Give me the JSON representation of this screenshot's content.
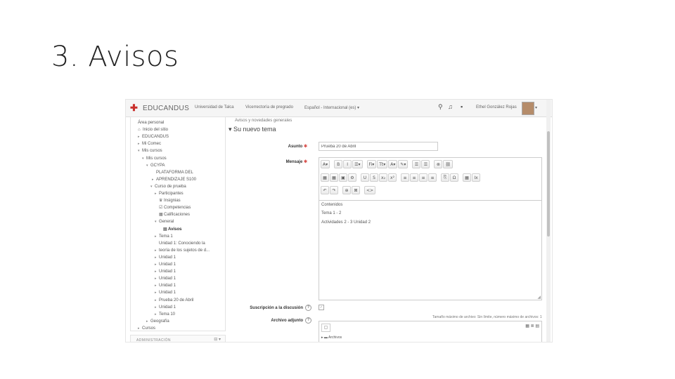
{
  "slide": {
    "title": "3. Avisos"
  },
  "navbar": {
    "brand": "EDUCANDUS",
    "links": [
      "Universidad de Talca",
      "Vicerrectoría de pregrado",
      "Español - Internacional (es) ▾"
    ],
    "icons": [
      "search-icon",
      "bell-icon",
      "chat-icon"
    ],
    "user": "Ethel González Rojas",
    "user_menu": "▾"
  },
  "sidebar": {
    "items": [
      {
        "label": "Área personal",
        "caret": "",
        "icon": ""
      },
      {
        "label": "Inicio del sitio",
        "caret": "",
        "icon": "⌂"
      },
      {
        "label": "EDUCANDUS",
        "caret": "▸",
        "icon": ""
      },
      {
        "label": "Mi Comec",
        "caret": "▸",
        "icon": ""
      },
      {
        "label": "Mis cursos",
        "caret": "▾",
        "icon": ""
      },
      {
        "label": "Mis cursos",
        "caret": "▾",
        "icon": ""
      },
      {
        "label": "GCYPA",
        "caret": "▾",
        "icon": ""
      },
      {
        "label": "PLATAFORMA DEL",
        "caret": "",
        "icon": ""
      },
      {
        "label": "APRENDIZAJE S100",
        "caret": "▸",
        "icon": ""
      },
      {
        "label": "Curso de prueba",
        "caret": "▾",
        "icon": ""
      },
      {
        "label": "Participantes",
        "caret": "▸",
        "icon": ""
      },
      {
        "label": "Insignias",
        "caret": "",
        "icon": "♛"
      },
      {
        "label": "Competencias",
        "caret": "",
        "icon": "☑"
      },
      {
        "label": "Calificaciones",
        "caret": "",
        "icon": "▦"
      },
      {
        "label": "General",
        "caret": "▾",
        "icon": ""
      },
      {
        "label": "Avisos",
        "caret": "",
        "icon": "▤"
      },
      {
        "label": "Tema 1",
        "caret": "▸",
        "icon": ""
      },
      {
        "label": "Unidad 1: Conociendo la",
        "caret": "",
        "icon": ""
      },
      {
        "label": "teoría de los sujetos de d...",
        "caret": "▸",
        "icon": ""
      },
      {
        "label": "Unidad 1",
        "caret": "▸",
        "icon": ""
      },
      {
        "label": "Unidad 1",
        "caret": "▸",
        "icon": ""
      },
      {
        "label": "Unidad 1",
        "caret": "▸",
        "icon": ""
      },
      {
        "label": "Unidad 1",
        "caret": "▸",
        "icon": ""
      },
      {
        "label": "Unidad 1",
        "caret": "▸",
        "icon": ""
      },
      {
        "label": "Unidad 1",
        "caret": "▸",
        "icon": ""
      },
      {
        "label": "Prueba 20 de Abril",
        "caret": "▸",
        "icon": ""
      },
      {
        "label": "Unidad 1",
        "caret": "▸",
        "icon": ""
      },
      {
        "label": "Tema 10",
        "caret": "▸",
        "icon": ""
      },
      {
        "label": "Geografía",
        "caret": "▸",
        "icon": ""
      },
      {
        "label": "Cursos",
        "caret": "▸",
        "icon": ""
      }
    ],
    "admin_title": "ADMINISTRACIÓN",
    "admin_icons": "⊟ ▾"
  },
  "main": {
    "breadcrumb": "Avisos y novedades generales",
    "section_title": "▾ Su nuevo tema",
    "subject_label": "Asunto",
    "subject_value": "Prueba 20 de Abril",
    "message_label": "Mensaje",
    "required_mark": "✱",
    "toolbar": {
      "row1": [
        "A▾",
        "B",
        "I",
        "☰▾",
        "Fi▾",
        "Tt▾",
        "A▾",
        "✎▾",
        "☰",
        "☰",
        "⊗",
        "⛓"
      ],
      "row2": [
        "▦",
        "▦",
        "▣",
        "⚙",
        "U",
        "S",
        "x₂",
        "x²",
        "≡",
        "≡",
        "≡",
        "≡",
        "⎘",
        "Ω",
        "▦",
        "Ix"
      ],
      "row3": [
        "↶",
        "↷",
        "⊕",
        "⊠",
        "<>"
      ]
    },
    "content_lines": [
      "Contenidos",
      "Tema 1 - 2",
      "Actividades 2 - 3 Unidad 2"
    ],
    "subscription_label": "Suscripción a la discusión",
    "attachment_label": "Archivo adjunto",
    "file_note": "Tamaño máximo de archivo: Sin límite, número máximo de archivos: 1",
    "files_label": "▸ ▬ Archivos"
  }
}
